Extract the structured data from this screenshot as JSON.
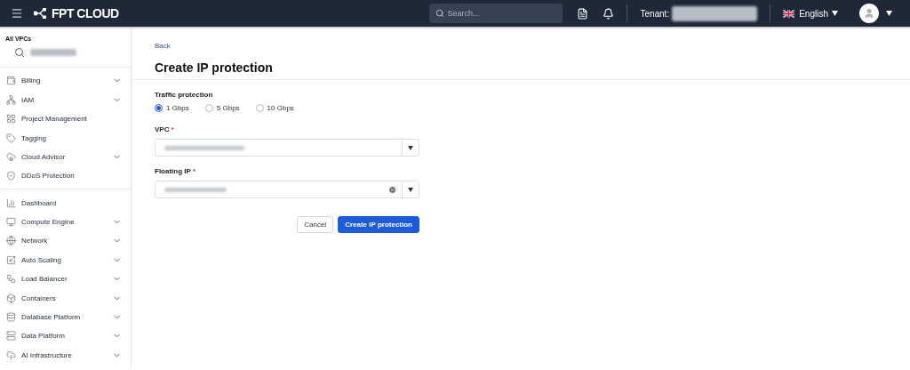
{
  "topbar": {
    "logo": "FPT CLOUD",
    "search": {
      "placeholder": "Search..."
    },
    "tenant_label": "Tenant:",
    "language": "English"
  },
  "sidebar": {
    "scope_label": "All VPCs",
    "groups": [
      [
        {
          "label": "Billing",
          "expandable": true
        },
        {
          "label": "IAM",
          "expandable": true
        },
        {
          "label": "Project Management",
          "expandable": false
        },
        {
          "label": "Tagging",
          "expandable": false
        },
        {
          "label": "Cloud Advisor",
          "expandable": true
        },
        {
          "label": "DDoS Protection",
          "expandable": false
        }
      ],
      [
        {
          "label": "Dashboard",
          "expandable": false
        },
        {
          "label": "Compute Engine",
          "expandable": true
        },
        {
          "label": "Network",
          "expandable": true
        },
        {
          "label": "Auto Scaling",
          "expandable": true
        },
        {
          "label": "Load Balancer",
          "expandable": true
        },
        {
          "label": "Containers",
          "expandable": true
        },
        {
          "label": "Database Platform",
          "expandable": true
        },
        {
          "label": "Data Platform",
          "expandable": true
        },
        {
          "label": "AI Infrastructure",
          "expandable": true
        }
      ]
    ]
  },
  "page": {
    "back": "Back",
    "title": "Create IP protection",
    "traffic": {
      "label": "Traffic protection",
      "options": [
        {
          "label": "1 Gbps",
          "selected": true
        },
        {
          "label": "5 Gbps",
          "selected": false
        },
        {
          "label": "10 Gbps",
          "selected": false
        }
      ]
    },
    "fields": [
      {
        "label": "VPC",
        "required_mark": "*",
        "clearable": false
      },
      {
        "label": "Floating IP",
        "required_mark": "*",
        "clearable": true
      }
    ],
    "buttons": [
      {
        "label": "Cancel",
        "kind": "secondary"
      },
      {
        "label": "Create IP protection",
        "kind": "primary"
      }
    ]
  }
}
